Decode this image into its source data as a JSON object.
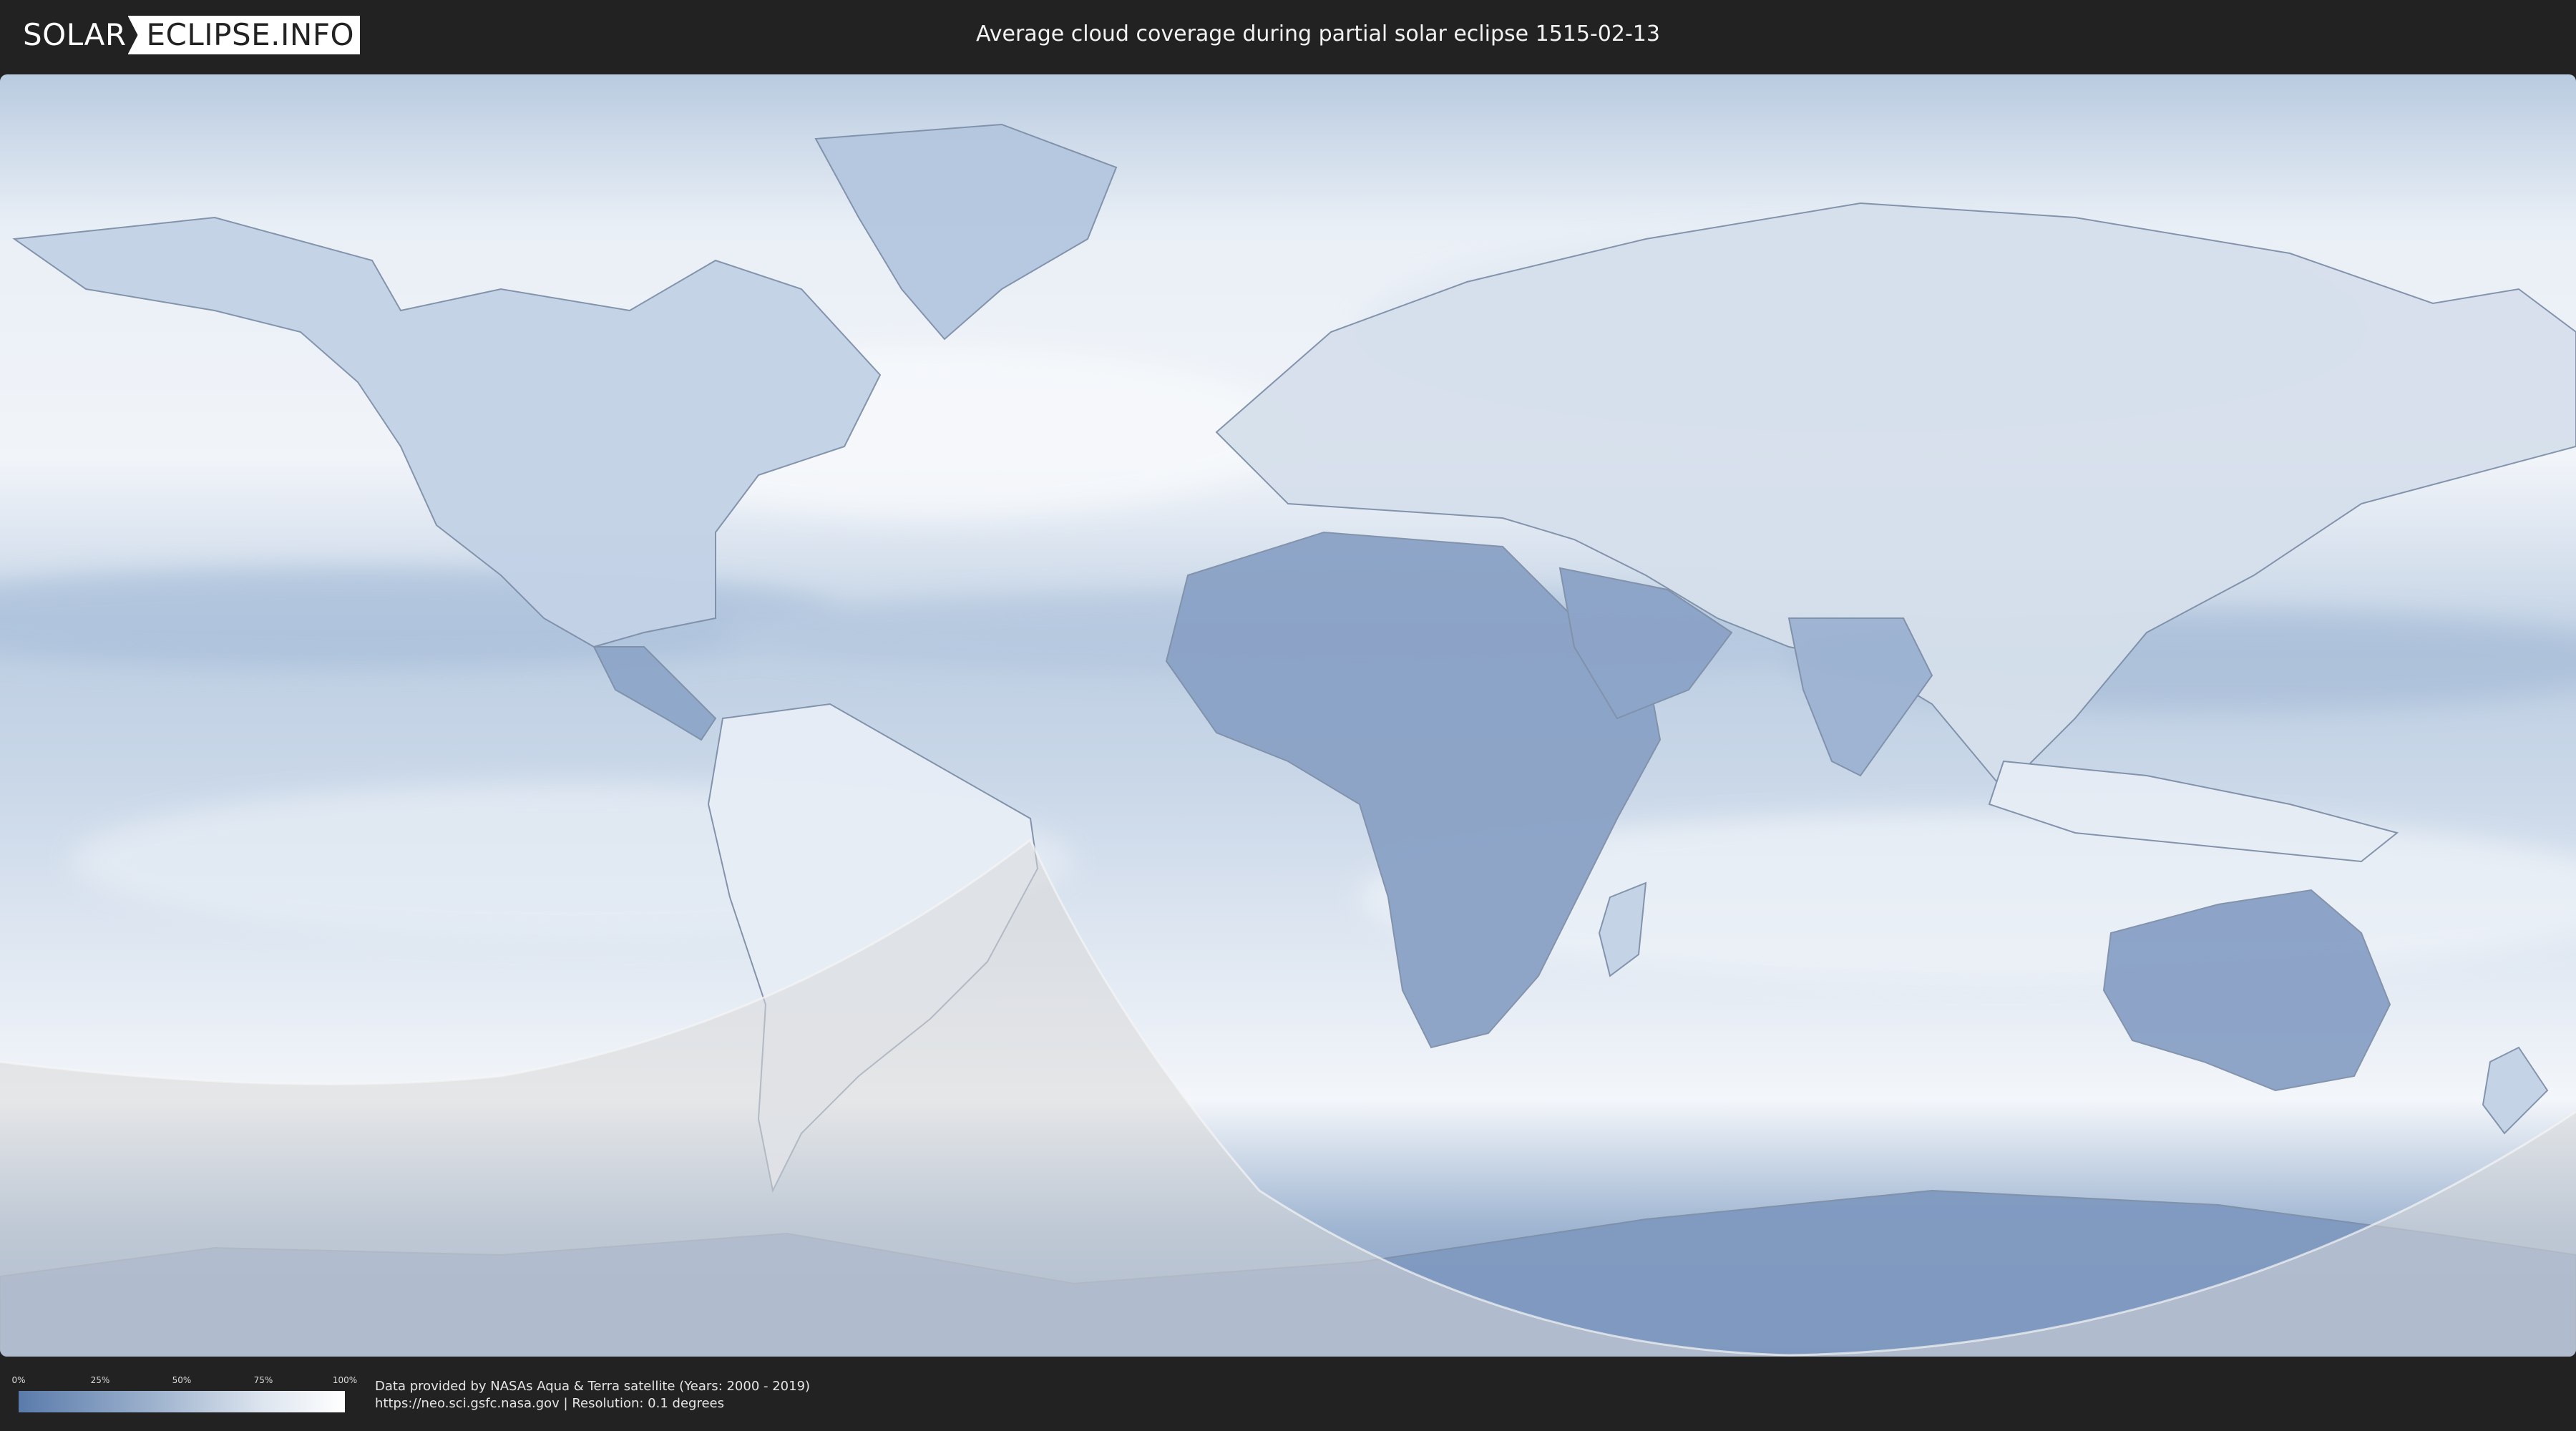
{
  "header": {
    "logo_left": "SOLAR",
    "logo_right": "ECLIPSE.INFO",
    "title": "Average cloud coverage during partial solar eclipse 1515-02-13"
  },
  "colors": {
    "background": "#222222",
    "cloud_low": "#5a7bab",
    "cloud_high": "#ffffff",
    "eclipse_shade": "#d8d8d8"
  },
  "legend": {
    "ticks": [
      "0%",
      "25%",
      "50%",
      "75%",
      "100%"
    ]
  },
  "credits": {
    "line1": "Data provided by NASAs Aqua & Terra satellite (Years: 2000 - 2019)",
    "line2": "https://neo.sci.gsfc.nasa.gov | Resolution: 0.1 degrees"
  }
}
